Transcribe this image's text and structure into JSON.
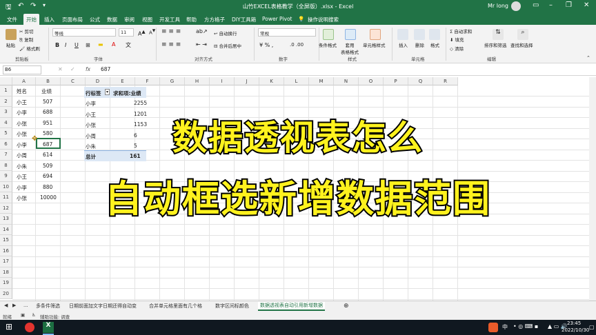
{
  "title": "山竹EXCEL表格教学（全屏版）.xlsx - Excel",
  "user": "Mr long",
  "tabs": [
    "文件",
    "开始",
    "插入",
    "页面布局",
    "公式",
    "数据",
    "审阅",
    "视图",
    "开发工具",
    "帮助",
    "方方格子",
    "DIY工具箱",
    "Power Pivot",
    "操作说明搜索"
  ],
  "active_tab": "开始",
  "ribbon": {
    "clipboard": {
      "cut": "剪切",
      "copy": "复制",
      "format_painter": "格式刷",
      "paste": "粘贴",
      "group": "剪贴板"
    },
    "font": {
      "name": "等线",
      "size": "11",
      "group": "字体",
      "bold": "B",
      "italic": "I",
      "underline": "U"
    },
    "alignment": {
      "wrap": "自动换行",
      "merge": "合并后居中",
      "group": "对齐方式"
    },
    "number": {
      "format": "常规",
      "group": "数字"
    },
    "styles": {
      "conditional": "条件格式",
      "table": "套用\n表格格式",
      "cell_styles": "单元格样式",
      "group": "样式"
    },
    "cells": {
      "insert": "插入",
      "delete": "删除",
      "format": "格式",
      "group": "单元格"
    },
    "editing": {
      "autosum": "自动求和",
      "fill": "填充",
      "clear": "清除",
      "sort": "排序和筛选",
      "find": "查找和选择",
      "group": "编辑"
    }
  },
  "formula_bar": {
    "name_box": "B6",
    "fx": "fx",
    "value": "687"
  },
  "columns": [
    "A",
    "B",
    "C",
    "D",
    "E",
    "F",
    "G",
    "H",
    "I",
    "J",
    "K",
    "L",
    "M",
    "N",
    "O",
    "P",
    "Q",
    "R"
  ],
  "rows": [
    "1",
    "2",
    "3",
    "4",
    "5",
    "6",
    "7",
    "8",
    "9",
    "10",
    "11",
    "12",
    "13",
    "14",
    "15",
    "16",
    "17",
    "18",
    "19",
    "20"
  ],
  "table": {
    "headers": [
      "姓名",
      "业绩"
    ],
    "rows": [
      [
        "小王",
        "507"
      ],
      [
        "小李",
        "688"
      ],
      [
        "小张",
        "951"
      ],
      [
        "小张",
        "580"
      ],
      [
        "小李",
        "687"
      ],
      [
        "小周",
        "614"
      ],
      [
        "小朱",
        "509"
      ],
      [
        "小王",
        "694"
      ],
      [
        "小李",
        "880"
      ],
      [
        "小张",
        "10000"
      ]
    ]
  },
  "pivot": {
    "headers": [
      "行标签",
      "求和项:业绩"
    ],
    "rows": [
      [
        "小李",
        "2255"
      ],
      [
        "小王",
        "1201"
      ],
      [
        "小张",
        "1153"
      ],
      [
        "小周",
        "6"
      ],
      [
        "小朱",
        "5"
      ]
    ],
    "total": [
      "总计",
      "161"
    ]
  },
  "overlay": {
    "line1": "数据透视表怎么",
    "line2": "自动框选新增数据范围"
  },
  "sheet_tabs": [
    "...",
    "多条件筛选",
    "日期前面加文字日期还得自动变",
    "合并单元格里面有几个格",
    "数字区间标颜色",
    "数据透视表自动引用新增数据"
  ],
  "active_sheet": "数据透视表自动引用新增数据",
  "status": {
    "ready": "就绪",
    "accessibility": "辅助功能: 调查"
  },
  "taskbar": {
    "time": "23:45",
    "date": "2022/10/30",
    "lang": "中"
  },
  "colors": {
    "excel_green": "#217346",
    "overlay_text": "#fff21e"
  }
}
